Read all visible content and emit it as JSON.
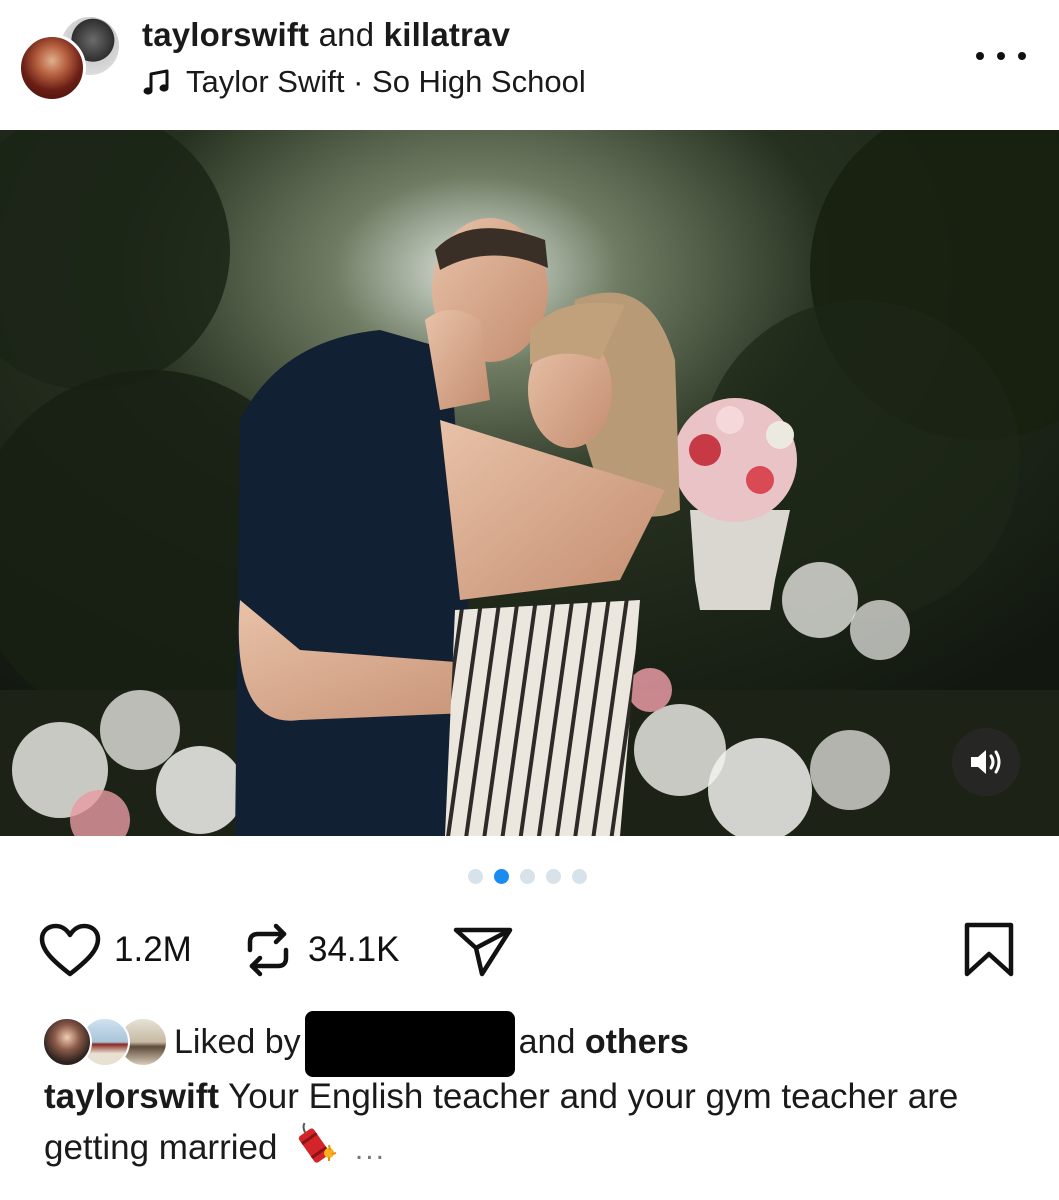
{
  "header": {
    "user1": "taylorswift",
    "conjunction": "and",
    "user2": "killatrav",
    "music_icon": "music-note-icon",
    "song": "Taylor Swift · So High School",
    "more_icon": "more-horizontal-icon"
  },
  "post": {
    "image_alt": "Couple embracing in a flower garden",
    "mute_icon": "speaker-icon",
    "carousel": {
      "count": 5,
      "active_index": 1
    }
  },
  "actions": {
    "like_icon": "heart-icon",
    "likes": "1.2M",
    "repost_icon": "repost-icon",
    "reposts": "34.1K",
    "share_icon": "send-icon",
    "save_icon": "bookmark-icon"
  },
  "likes": {
    "prefix": "Liked by",
    "suffix_and": "and",
    "suffix_others": "others"
  },
  "caption": {
    "user": "taylorswift",
    "text": "Your English teacher and your gym teacher are getting married",
    "emoji": "firecracker-icon",
    "more": "..."
  },
  "colors": {
    "accent": "#1a8cf0",
    "text": "#1a1a1a"
  }
}
